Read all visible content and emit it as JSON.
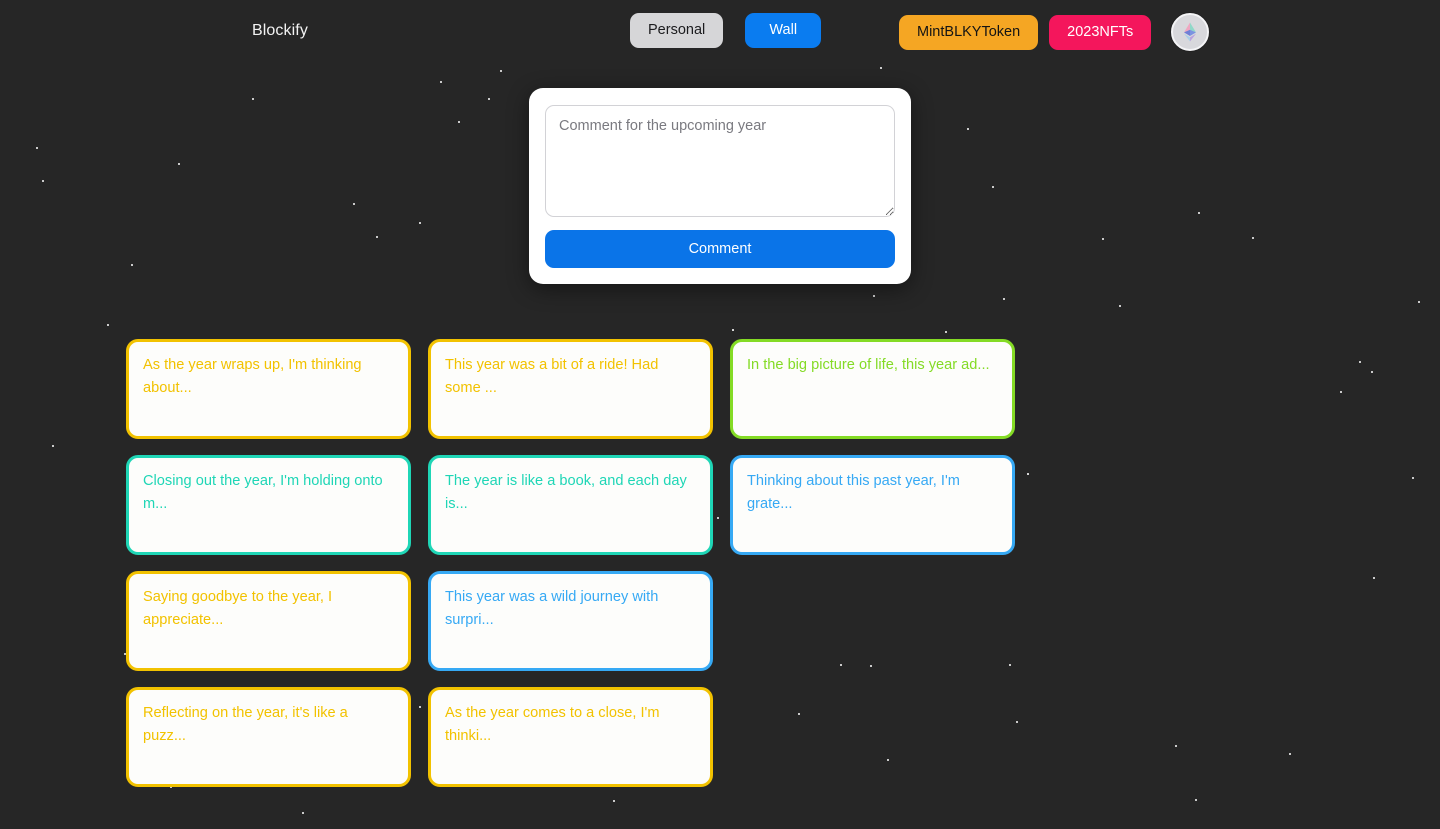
{
  "app": {
    "brand": "Blockify",
    "background_color": "#262626"
  },
  "navbar": {
    "left_buttons": [
      {
        "label": "Personal",
        "name": "nav-personal-button",
        "style": "pill-personal",
        "color": "#d6d6d8"
      },
      {
        "label": "Wall",
        "name": "nav-wall-button",
        "style": "pill-wall",
        "color": "#0a7cf0"
      }
    ],
    "right_buttons": [
      {
        "label": "MintBLKYToken",
        "name": "mint-token-button",
        "style": "pill-mint",
        "color": "#f5a623"
      },
      {
        "label": "2023NFTs",
        "name": "nfts-button",
        "style": "pill-nfts",
        "color": "#f4165c"
      }
    ],
    "avatar": {
      "icon": "ethereum-icon",
      "name": "wallet-avatar-button"
    }
  },
  "comment_modal": {
    "textarea_placeholder": "Comment for the upcoming year",
    "textarea_value": "",
    "submit_label": "Comment",
    "submit_color": "#0a74e8"
  },
  "wall": {
    "cards": [
      {
        "text": "As the year wraps up, I'm thinking about...",
        "color": "#f2c200"
      },
      {
        "text": "This year was a bit of a ride! Had some ...",
        "color": "#f2c200"
      },
      {
        "text": "In the big picture of life, this year ad...",
        "color": "#84db25"
      },
      {
        "text": "Closing out the year, I'm holding onto m...",
        "color": "#1fd6b6"
      },
      {
        "text": "The year is like a book, and each day is...",
        "color": "#1fd6b6"
      },
      {
        "text": "Thinking about this past year, I'm grate...",
        "color": "#36a9f4"
      },
      {
        "text": "Saying goodbye to the year, I appreciate...",
        "color": "#f2c200"
      },
      {
        "text": "This year was a wild journey with surpri...",
        "color": "#36a9f4"
      },
      {
        "text": "",
        "color": "transparent",
        "empty": true
      },
      {
        "text": "Reflecting on the year, it's like a puzz...",
        "color": "#f2c200"
      },
      {
        "text": "As the year comes to a close, I'm thinki...",
        "color": "#f2c200"
      }
    ]
  },
  "stars": [
    [
      441,
      82,
      2.6
    ],
    [
      501,
      71,
      2.4
    ],
    [
      253,
      99,
      2.2
    ],
    [
      489,
      99,
      2.4
    ],
    [
      459,
      122,
      2.0
    ],
    [
      881,
      68,
      2.6
    ],
    [
      968,
      129,
      2.6
    ],
    [
      993,
      187,
      2.4
    ],
    [
      1103,
      239,
      2.2
    ],
    [
      1199,
      213,
      2.4
    ],
    [
      1253,
      238,
      2.6
    ],
    [
      37,
      148,
      2.2
    ],
    [
      43,
      181,
      2.4
    ],
    [
      179,
      164,
      2.0
    ],
    [
      354,
      204,
      2.6
    ],
    [
      420,
      223,
      2.4
    ],
    [
      377,
      237,
      2.6
    ],
    [
      132,
      265,
      2.2
    ],
    [
      108,
      325,
      2.6
    ],
    [
      874,
      296,
      2.6
    ],
    [
      1004,
      299,
      2.4
    ],
    [
      1120,
      306,
      2.2
    ],
    [
      1419,
      302,
      2.6
    ],
    [
      946,
      332,
      2.2
    ],
    [
      1360,
      362,
      2.0
    ],
    [
      1372,
      372,
      2.4
    ],
    [
      1341,
      392,
      2.4
    ],
    [
      53,
      446,
      2.2
    ],
    [
      718,
      518,
      2.8
    ],
    [
      1413,
      478,
      2.2
    ],
    [
      1374,
      578,
      2.6
    ],
    [
      150,
      587,
      2.4
    ],
    [
      330,
      589,
      2.4
    ],
    [
      125,
      654,
      2.6
    ],
    [
      269,
      670,
      2.4
    ],
    [
      255,
      638,
      2.2
    ],
    [
      420,
      707,
      2.6
    ],
    [
      799,
      714,
      2.4
    ],
    [
      841,
      665,
      2.6
    ],
    [
      871,
      666,
      2.4
    ],
    [
      1017,
      722,
      2.2
    ],
    [
      1176,
      746,
      2.6
    ],
    [
      1290,
      754,
      2.4
    ],
    [
      888,
      760,
      2.6
    ],
    [
      303,
      813,
      2.6
    ],
    [
      614,
      801,
      2.4
    ],
    [
      1196,
      800,
      2.4
    ],
    [
      171,
      787,
      2.2
    ],
    [
      1010,
      665,
      2.0
    ],
    [
      583,
      648,
      1.8
    ],
    [
      700,
      472,
      1.8
    ],
    [
      1028,
      474,
      1.8
    ],
    [
      733,
      330,
      1.8
    ]
  ]
}
